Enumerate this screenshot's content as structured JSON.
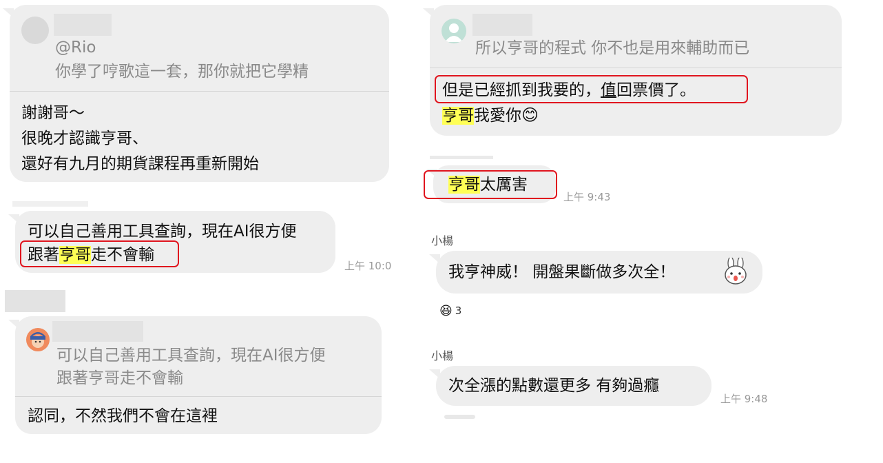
{
  "left": {
    "b1": {
      "mention": "@Rio",
      "quote": "你學了哼歌這一套，那你就把它學精",
      "lines": [
        "謝謝哥～",
        "很晚才認識亨哥、",
        "還好有九月的期貨課程再重新開始"
      ]
    },
    "b2": {
      "line1": "可以自己善用工具查詢，現在AI很方便",
      "line2_a": "跟著",
      "line2_hl": "亨哥",
      "line2_b": "走不會輸",
      "time": "上午 10:0"
    },
    "b3": {
      "quote1": "可以自己善用工具查詢，現在AI很方便",
      "quote2": "跟著亨哥走不會輸",
      "reply": "認同，不然我們不會在這裡"
    }
  },
  "right": {
    "b1": {
      "quote": "所以亨哥的程式 你不也是用來輔助而已",
      "line1_a": "但是已經抓到我要的，",
      "line1_u": "值",
      "line1_b": "回票價了。",
      "line2_hl": "亨哥",
      "line2_b": "我愛你",
      "emoji": "😊"
    },
    "b2": {
      "hl": "亨哥",
      "rest": "太厲害",
      "time": "上午 9:43"
    },
    "b3": {
      "sender": "小楊",
      "text": "我亨神威！ 開盤果斷做多次全！",
      "sticker": "🐰",
      "reaction_icon": "😆",
      "reaction_count": "3"
    },
    "b4": {
      "sender": "小楊",
      "text": "次全漲的點數還更多 有夠過癮",
      "time": "上午 9:48"
    }
  },
  "colors": {
    "bubble": "#eeeeee",
    "highlight": "#ffff55",
    "outline": "#e0141e"
  }
}
